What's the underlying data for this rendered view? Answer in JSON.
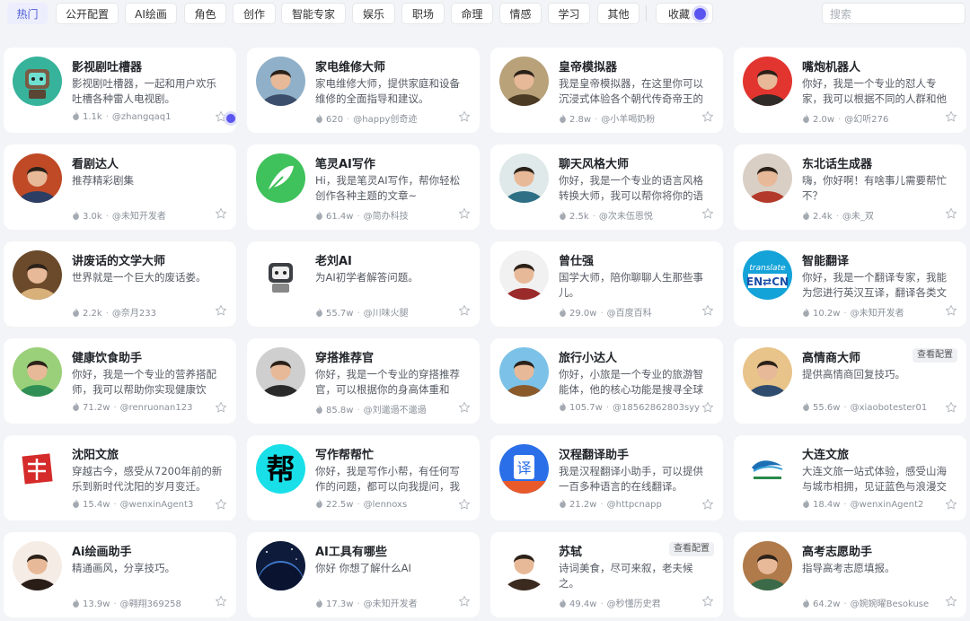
{
  "tabs": [
    {
      "label": "热门",
      "active": true
    },
    {
      "label": "公开配置"
    },
    {
      "label": "AI绘画"
    },
    {
      "label": "角色"
    },
    {
      "label": "创作"
    },
    {
      "label": "智能专家"
    },
    {
      "label": "娱乐"
    },
    {
      "label": "职场"
    },
    {
      "label": "命理"
    },
    {
      "label": "情感"
    },
    {
      "label": "学习"
    },
    {
      "label": "其他"
    }
  ],
  "favorites_label": "收藏",
  "search": {
    "placeholder": "搜索"
  },
  "card_button_label": "查看配置",
  "cards": [
    {
      "title": "影视剧吐槽器",
      "desc": "影视剧吐槽器，一起和用户欢乐吐槽各种雷人电视剧。",
      "count": "1.1k",
      "author": "@zhangqaq1",
      "avatar_icon": "tv-robot-icon",
      "colors": [
        "#37b39b",
        "#f6d2a2"
      ]
    },
    {
      "title": "家电维修大师",
      "desc": "家电维修大师，提供家庭和设备维修的全面指导和建议。",
      "count": "620",
      "author": "@happy创奇迹",
      "avatar_icon": "repairman-icon",
      "colors": [
        "#8fb0c8",
        "#3b4e6b"
      ]
    },
    {
      "title": "皇帝模拟器",
      "desc": "我是皇帝模拟器，在这里你可以沉浸式体验各个朝代传奇帝王的一…",
      "count": "2.8w",
      "author": "@小羊喝奶粉",
      "avatar_icon": "emperor-icon",
      "colors": [
        "#b9a27a",
        "#4b3a24"
      ]
    },
    {
      "title": "嘴炮机器人",
      "desc": "你好，我是一个专业的怼人专家，我可以根据不同的人群和他们的…",
      "count": "2.0w",
      "author": "@幻听276",
      "avatar_icon": "dog-icon",
      "colors": [
        "#e2352f",
        "#2f2b28"
      ]
    },
    {
      "title": "看剧达人",
      "desc": "推荐精彩剧集",
      "count": "3.0k",
      "author": "@未知开发者",
      "avatar_icon": "man-portrait-icon",
      "colors": [
        "#c04a26",
        "#2c3e64"
      ]
    },
    {
      "title": "笔灵AI写作",
      "desc": "Hi，我是笔灵AI写作，帮你轻松创作各种主题的文章~",
      "count": "61.4w",
      "author": "@简办科技",
      "avatar_icon": "feather-icon",
      "colors": [
        "#3fc25b",
        "#ffffff"
      ]
    },
    {
      "title": "聊天风格大师",
      "desc": "你好，我是一个专业的语言风格转换大师，我可以帮你将你的语言…",
      "count": "2.5k",
      "author": "@次未伍恩悦",
      "avatar_icon": "meditate-icon",
      "colors": [
        "#dfe9ea",
        "#2f6f86"
      ]
    },
    {
      "title": "东北话生成器",
      "desc": "嗨，你好啊！有啥事儿需要帮忙不？",
      "count": "2.4k",
      "author": "@未_双",
      "avatar_icon": "hat-man-icon",
      "colors": [
        "#d9cfc4",
        "#b33a2a"
      ]
    },
    {
      "title": "讲废话的文学大师",
      "desc": "世界就是一个巨大的废话娄。",
      "count": "2.2k",
      "author": "@奈月233",
      "avatar_icon": "writer-icon",
      "colors": [
        "#6a4a2a",
        "#d8b07a"
      ]
    },
    {
      "title": "老刘AI",
      "desc": "为AI初学者解答问题。",
      "count": "55.7w",
      "author": "@川味火腿",
      "avatar_icon": "robot-icon",
      "colors": [
        "#ffffff",
        "#3c3f44"
      ]
    },
    {
      "title": "曾仕强",
      "desc": "国学大师，陪你聊聊人生那些事儿。",
      "count": "29.0w",
      "author": "@百度百科",
      "avatar_icon": "old-man-icon",
      "colors": [
        "#f1f1f1",
        "#9b2a2a"
      ]
    },
    {
      "title": "智能翻译",
      "desc": "你好，我是一个翻译专家，我能为您进行英汉互译，翻译各类文章…",
      "count": "10.2w",
      "author": "@未知开发者",
      "avatar_icon": "translate-icon",
      "colors": [
        "#14a3d8",
        "#ffffff"
      ]
    },
    {
      "title": "健康饮食助手",
      "desc": "你好，我是一个专业的营养搭配师，我可以帮助你实现健康饮食…",
      "count": "71.2w",
      "author": "@renruonan123",
      "avatar_icon": "girl-veggie-icon",
      "colors": [
        "#9bd07a",
        "#2f8f55"
      ]
    },
    {
      "title": "穿搭推荐官",
      "desc": "你好，我是一个专业的穿搭推荐官，可以根据你的身高体重和需…",
      "count": "85.8w",
      "author": "@刘邋遢不邋遢",
      "avatar_icon": "woman-suit-icon",
      "colors": [
        "#cfcfcf",
        "#2a2a2a"
      ]
    },
    {
      "title": "旅行小达人",
      "desc": "你好，小旅是一个专业的旅游智能体，他的核心功能是搜寻全球各…",
      "count": "105.7w",
      "author": "@18562862803syy",
      "avatar_icon": "traveler-icon",
      "colors": [
        "#7cc2e8",
        "#8b5a2b"
      ]
    },
    {
      "title": "高情商大师",
      "desc": "提供高情商回复技巧。",
      "count": "55.6w",
      "author": "@xiaobotester01",
      "avatar_icon": "reader-icon",
      "colors": [
        "#e8c48a",
        "#2f4c6e"
      ],
      "show_config": true
    },
    {
      "title": "沈阳文旅",
      "desc": "穿越古今，感受从7200年前的新乐到新时代沈阳的岁月变迁。",
      "count": "15.4w",
      "author": "@wenxinAgent3",
      "avatar_icon": "seal-icon",
      "colors": [
        "#ffffff",
        "#d52b2b"
      ]
    },
    {
      "title": "写作帮帮忙",
      "desc": "你好，我是写作小帮，有任何写作的问题，都可以向我提问，我们…",
      "count": "22.5w",
      "author": "@lennoxs",
      "avatar_icon": "bang-icon",
      "colors": [
        "#19e0e8",
        "#000000"
      ],
      "glyph": "帮"
    },
    {
      "title": "汉程翻译助手",
      "desc": "我是汉程翻译小助手，可以提供一百多种语言的在线翻译。",
      "count": "21.2w",
      "author": "@httpcnapp",
      "avatar_icon": "translate-doc-icon",
      "colors": [
        "#2a6fe8",
        "#ffffff"
      ],
      "glyph": "译"
    },
    {
      "title": "大连文旅",
      "desc": "大连文旅一站式体验，感受山海与城市相拥，见证蓝色与浪漫交融!",
      "count": "18.4w",
      "author": "@wenxinAgent2",
      "avatar_icon": "wave-logo-icon",
      "colors": [
        "#ffffff",
        "#1c6fb5"
      ]
    },
    {
      "title": "Ai绘画助手",
      "desc": "精通画风，分享技巧。",
      "count": "13.9w",
      "author": "@翱翔369258",
      "avatar_icon": "woman-portrait-icon",
      "colors": [
        "#f5ece6",
        "#2a1d18"
      ]
    },
    {
      "title": "AI工具有哪些",
      "desc": "你好 你想了解什么AI",
      "count": "17.3w",
      "author": "@未知开发者",
      "avatar_icon": "planet-icon",
      "colors": [
        "#0e1b3a",
        "#3f77c9"
      ]
    },
    {
      "title": "苏轼",
      "desc": "诗词美食，尽可来叙，老夫候之。",
      "count": "49.4w",
      "author": "@秒懂历史君",
      "avatar_icon": "scholar-icon",
      "colors": [
        "#ffffff",
        "#3a2a20"
      ],
      "show_config": true
    },
    {
      "title": "高考志愿助手",
      "desc": "指导高考志愿填报。",
      "count": "64.2w",
      "author": "@婉婉曜Besokuse",
      "avatar_icon": "student-icon",
      "colors": [
        "#b07a4a",
        "#3a6a48"
      ]
    }
  ]
}
